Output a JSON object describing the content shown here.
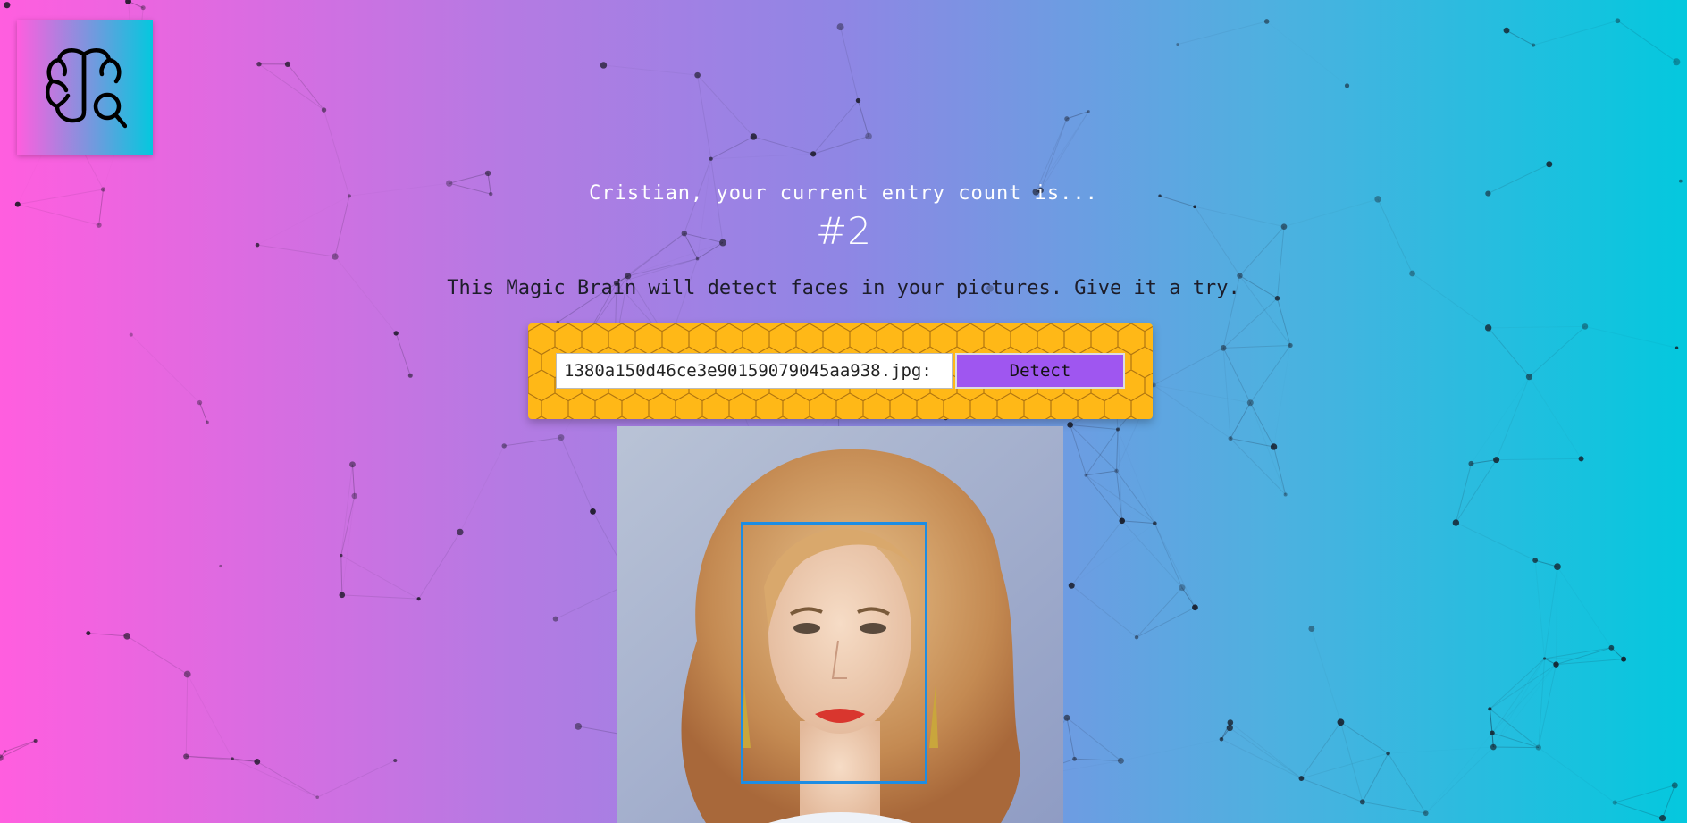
{
  "app": {
    "logo_icon": "brain-magnifier-icon"
  },
  "entries": {
    "greeting": "Cristian, your current entry count is...",
    "count": "#2"
  },
  "intro": {
    "text": "This Magic Brain will detect faces in your pictures. Give it a try."
  },
  "form": {
    "url_value": ":1380a150d46ce3e90159079045aa938.jpg",
    "detect_label": "Detect"
  },
  "result": {
    "image_subject": "portrait-photo",
    "face_box_color": "#1d8de4"
  },
  "colors": {
    "gradient_left": "#ff5edf",
    "gradient_right": "#04c8de",
    "form_background": "#ffb817",
    "button": "#9f56f0"
  }
}
